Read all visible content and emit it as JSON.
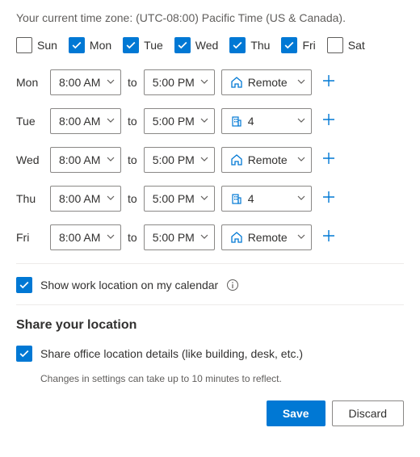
{
  "timezone_text": "Your current time zone: (UTC-08:00) Pacific Time (US & Canada).",
  "weekdays": [
    {
      "abbr": "Sun",
      "checked": false
    },
    {
      "abbr": "Mon",
      "checked": true
    },
    {
      "abbr": "Tue",
      "checked": true
    },
    {
      "abbr": "Wed",
      "checked": true
    },
    {
      "abbr": "Thu",
      "checked": true
    },
    {
      "abbr": "Fri",
      "checked": true
    },
    {
      "abbr": "Sat",
      "checked": false
    }
  ],
  "to_label": "to",
  "schedule": [
    {
      "day": "Mon",
      "start": "8:00 AM",
      "end": "5:00 PM",
      "location": "Remote",
      "loc_type": "home"
    },
    {
      "day": "Tue",
      "start": "8:00 AM",
      "end": "5:00 PM",
      "location": "4",
      "loc_type": "building"
    },
    {
      "day": "Wed",
      "start": "8:00 AM",
      "end": "5:00 PM",
      "location": "Remote",
      "loc_type": "home"
    },
    {
      "day": "Thu",
      "start": "8:00 AM",
      "end": "5:00 PM",
      "location": "4",
      "loc_type": "building"
    },
    {
      "day": "Fri",
      "start": "8:00 AM",
      "end": "5:00 PM",
      "location": "Remote",
      "loc_type": "home"
    }
  ],
  "show_location": {
    "checked": true,
    "label": "Show work location on my calendar"
  },
  "share_heading": "Share your location",
  "share_details": {
    "checked": true,
    "label": "Share office location details (like building, desk, etc.)"
  },
  "hint": "Changes in settings can take up to 10 minutes to reflect.",
  "buttons": {
    "save": "Save",
    "discard": "Discard"
  }
}
